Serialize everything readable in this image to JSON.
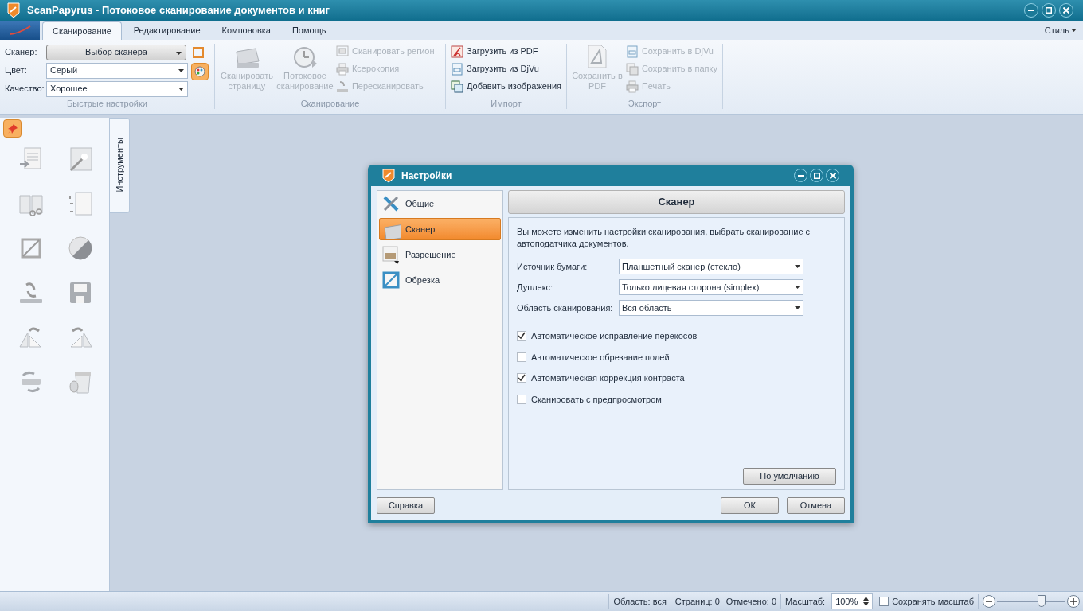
{
  "window": {
    "title": "ScanPapyrus - Потоковое сканирование документов и книг"
  },
  "menu_tabs": [
    {
      "label": "Сканирование",
      "selected": true
    },
    {
      "label": "Редактирование",
      "selected": false
    },
    {
      "label": "Компоновка",
      "selected": false
    },
    {
      "label": "Помощь",
      "selected": false
    }
  ],
  "style_menu": "Стиль",
  "quick_settings": {
    "fields": [
      {
        "label": "Сканер:",
        "value": "Выбор сканера",
        "kind": "button"
      },
      {
        "label": "Цвет:",
        "value": "Серый",
        "kind": "combo"
      },
      {
        "label": "Качество:",
        "value": "Хорошее",
        "kind": "combo"
      }
    ],
    "group_label": "Быстрые настройки"
  },
  "scan_group": {
    "large": [
      {
        "label": "Сканировать страницу",
        "disabled": true
      },
      {
        "label": "Потоковое сканирование",
        "disabled": true
      }
    ],
    "small": [
      {
        "label": "Сканировать регион",
        "disabled": true
      },
      {
        "label": "Ксерокопия",
        "disabled": true
      },
      {
        "label": "Пересканировать",
        "disabled": true
      }
    ],
    "group_label": "Сканирование"
  },
  "import_group": {
    "small": [
      {
        "label": "Загрузить из PDF",
        "disabled": false
      },
      {
        "label": "Загрузить из DjVu",
        "disabled": false
      },
      {
        "label": "Добавить изображения",
        "disabled": false
      }
    ],
    "group_label": "Импорт"
  },
  "export_group": {
    "large": [
      {
        "label": "Сохранить в PDF",
        "disabled": true
      }
    ],
    "small": [
      {
        "label": "Сохранить в DjVu",
        "disabled": true
      },
      {
        "label": "Сохранить в папку",
        "disabled": true
      },
      {
        "label": "Печать",
        "disabled": true
      }
    ],
    "group_label": "Экспорт"
  },
  "tools_tab": "Инструменты",
  "dialog": {
    "title": "Настройки",
    "nav": [
      {
        "label": "Общие",
        "selected": false
      },
      {
        "label": "Сканер",
        "selected": true
      },
      {
        "label": "Разрешение",
        "selected": false
      },
      {
        "label": "Обрезка",
        "selected": false
      }
    ],
    "heading": "Сканер",
    "description": "Вы можете изменить настройки сканирования, выбрать сканирование с автоподатчика документов.",
    "fields": [
      {
        "label": "Источник бумаги:",
        "value": "Планшетный сканер (стекло)"
      },
      {
        "label": "Дуплекс:",
        "value": "Только лицевая сторона (simplex)"
      },
      {
        "label": "Область сканирования:",
        "value": "Вся область"
      }
    ],
    "options": [
      {
        "label": "Автоматическое исправление перекосов",
        "checked": true
      },
      {
        "label": "Автоматическое обрезание полей",
        "checked": false
      },
      {
        "label": "Автоматическая коррекция контраста",
        "checked": true
      },
      {
        "label": "Сканировать с предпросмотром",
        "checked": false
      }
    ],
    "default_button": "По умолчанию",
    "help_button": "Справка",
    "ok_button": "ОК",
    "cancel_button": "Отмена"
  },
  "status_bar": {
    "area": "Область: вся",
    "pages": "Страниц: 0",
    "marked": "Отмечено: 0",
    "zoom_label": "Масштаб:",
    "zoom_value": "100%",
    "keep_zoom": {
      "label": "Сохранять масштаб",
      "checked": false
    },
    "zoom_slider": {
      "level": 0.65
    }
  }
}
